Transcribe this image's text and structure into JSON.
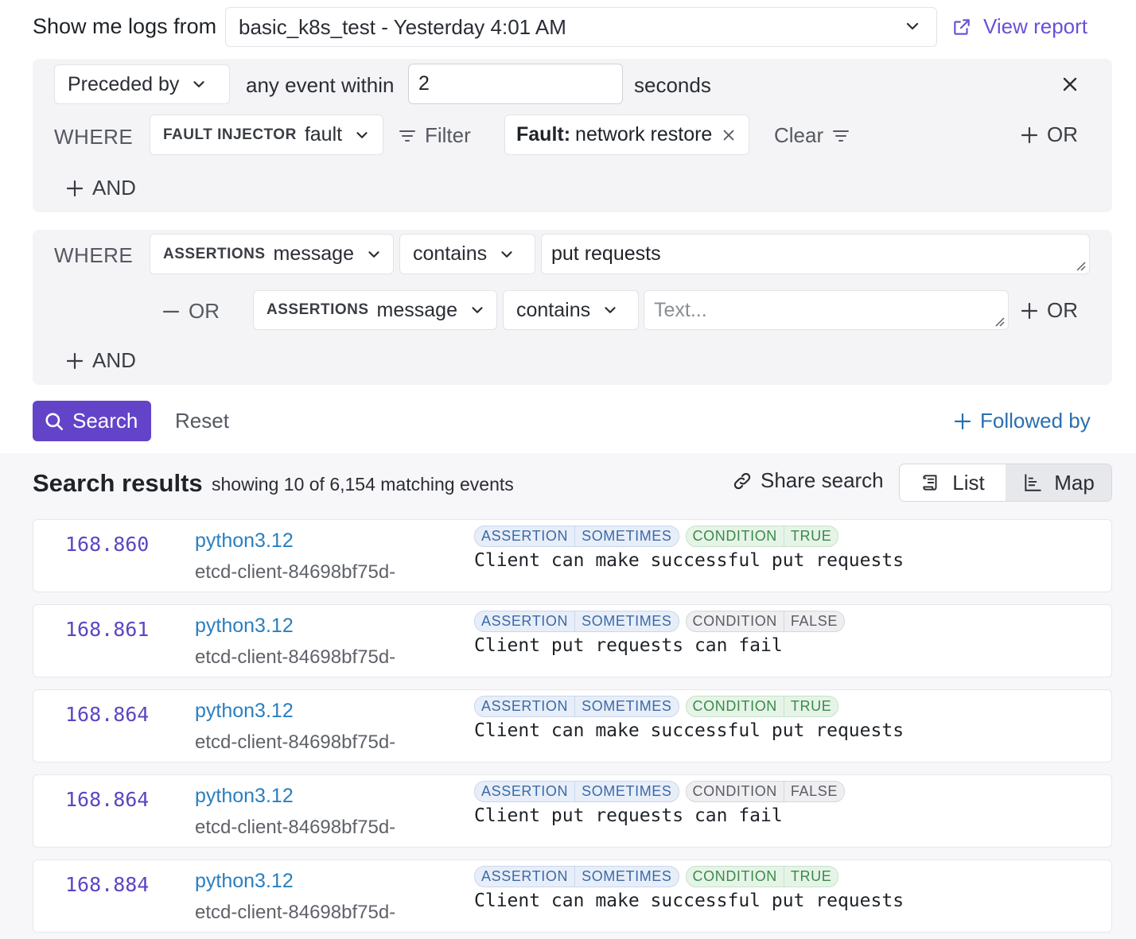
{
  "header": {
    "show_label": "Show me logs from",
    "report_value": "basic_k8s_test - Yesterday 4:01 AM",
    "view_report": "View report"
  },
  "preceded_group": {
    "mode": "Preceded by",
    "any_event_within": "any event within",
    "seconds_value": "2",
    "seconds_label": "seconds",
    "where_label": "WHERE",
    "field_caption": "FAULT INJECTOR",
    "field_name": "fault",
    "filter_label": "Filter",
    "chip_key": "Fault:",
    "chip_value": "network restore",
    "clear_label": "Clear",
    "or_label": "OR",
    "and_label": "AND"
  },
  "where_group": {
    "where_label": "WHERE",
    "conditions": [
      {
        "caption": "ASSERTIONS",
        "field": "message",
        "operator": "contains",
        "value": "put requests",
        "placeholder": ""
      },
      {
        "prefix": "OR",
        "caption": "ASSERTIONS",
        "field": "message",
        "operator": "contains",
        "value": "",
        "placeholder": "Text..."
      }
    ],
    "or_label": "OR",
    "and_label": "AND"
  },
  "actions": {
    "search": "Search",
    "reset": "Reset",
    "followed_by": "Followed by"
  },
  "results": {
    "title": "Search results",
    "subtitle": "showing 10 of 6,154 matching events",
    "share": "Share search",
    "view_list": "List",
    "view_map": "Map",
    "tag_assertion": "ASSERTION",
    "tag_sometimes": "SOMETIMES",
    "tag_condition": "CONDITION",
    "rows": [
      {
        "time": "168.860",
        "process": "python3.12",
        "host": "etcd-client-84698bf75d-",
        "condition": "TRUE",
        "message": "Client can make successful put requests"
      },
      {
        "time": "168.861",
        "process": "python3.12",
        "host": "etcd-client-84698bf75d-",
        "condition": "FALSE",
        "message": "Client put requests can fail"
      },
      {
        "time": "168.864",
        "process": "python3.12",
        "host": "etcd-client-84698bf75d-",
        "condition": "TRUE",
        "message": "Client can make successful put requests"
      },
      {
        "time": "168.864",
        "process": "python3.12",
        "host": "etcd-client-84698bf75d-",
        "condition": "FALSE",
        "message": "Client put requests can fail"
      },
      {
        "time": "168.884",
        "process": "python3.12",
        "host": "etcd-client-84698bf75d-",
        "condition": "TRUE",
        "message": "Client can make successful put requests"
      }
    ]
  },
  "colors": {
    "accent": "#6344c9",
    "link": "#2a6fb0",
    "timestamp": "#5d45c2",
    "true_tag": "#3a8a4a",
    "assertion_tag": "#3b6aa8"
  }
}
